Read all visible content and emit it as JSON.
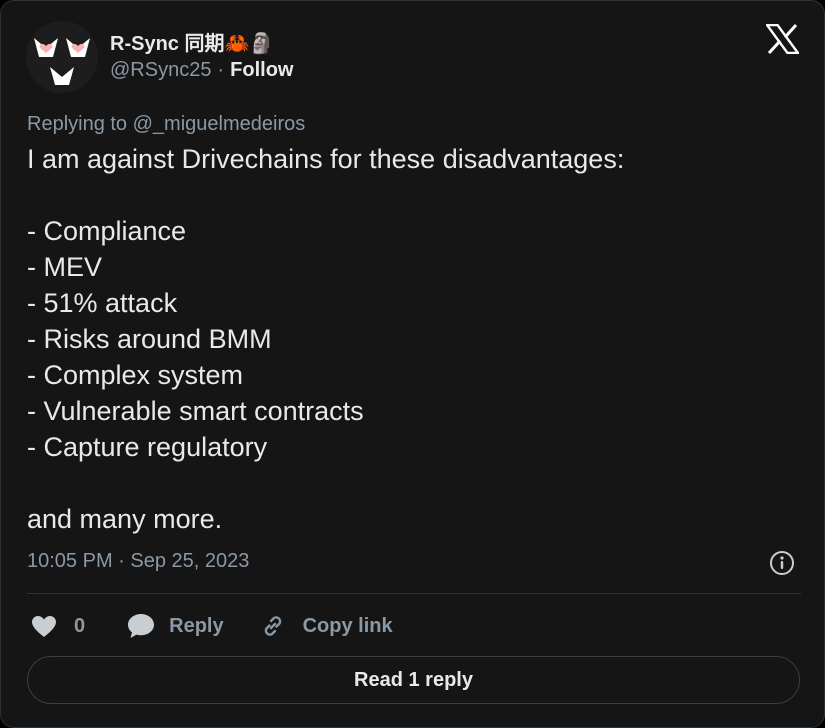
{
  "author": {
    "display_name": "R-Sync 同期🦀🗿",
    "handle": "@RSync25",
    "separator": "·",
    "follow_label": "Follow",
    "avatar_icon": "heart-eyes-face-avatar"
  },
  "brand_icon": "x-logo-icon",
  "reply_context": {
    "prefix": "Replying to",
    "mention": "@_miguelmedeiros"
  },
  "post": {
    "text": "I am against Drivechains for these disadvantages:\n\n- Compliance\n- MEV\n- 51% attack\n- Risks around BMM\n- Complex system\n- Vulnerable smart contracts\n- Capture regulatory\n\nand many more.",
    "timestamp": "10:05 PM · Sep 25, 2023"
  },
  "actions": {
    "like_count": "0",
    "reply_label": "Reply",
    "copy_label": "Copy link"
  },
  "read_replies_label": "Read 1 reply",
  "colors": {
    "background": "#151515",
    "text_primary": "#e7e9ea",
    "text_secondary": "#8b98a5",
    "border": "#2f3336",
    "avatar_accent": "#f8b4b4"
  }
}
